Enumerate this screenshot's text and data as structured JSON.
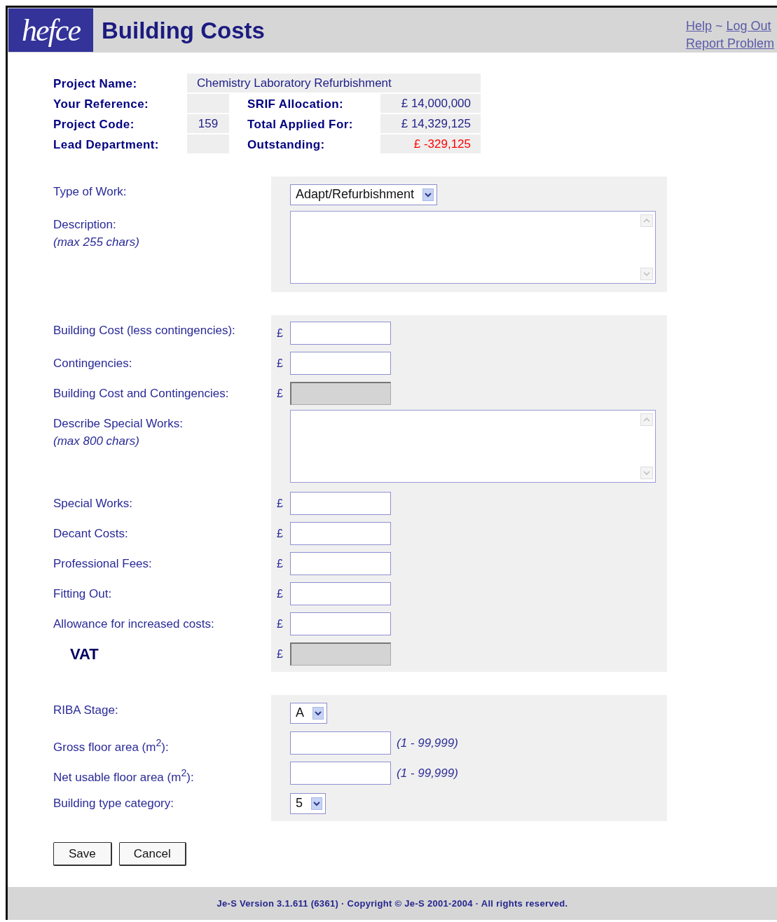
{
  "header": {
    "logo": "hefce",
    "title": "Building Costs",
    "links": [
      {
        "label": "Help"
      },
      {
        "label": "Log Out"
      }
    ],
    "separator": "~",
    "second_link": {
      "label": "Report Problem"
    }
  },
  "summary": {
    "name_label": "Project Name:",
    "name_value": "Chemistry Laboratory Refurbishment",
    "rows": [
      {
        "label": "Your Reference:",
        "label2": "SRIF Allocation:",
        "value2": "£ 14,000,000",
        "alert": false
      },
      {
        "label": "Project Code:",
        "value": "159",
        "label2": "Total Applied For:",
        "value2": "£ 14,329,125",
        "alert": false
      },
      {
        "label": "Lead Department:",
        "label2": "Outstanding:",
        "value2": "£ -329,125",
        "alert": true
      }
    ]
  },
  "sections": [
    {
      "rows": [
        {
          "kind": "select",
          "label": "Type of Work:",
          "value": "Adapt/Refurbishment"
        },
        {
          "kind": "textarea",
          "label": "Description:",
          "note": "(max 255 chars)"
        }
      ]
    },
    {
      "rows": [
        {
          "kind": "money",
          "label": "Building Cost (less contingencies):",
          "currency": "£",
          "disabled": false
        },
        {
          "kind": "money",
          "label": "Contingencies:",
          "currency": "£",
          "disabled": false
        },
        {
          "kind": "money",
          "label": "Building Cost and Contingencies:",
          "currency": "£",
          "disabled": true
        },
        {
          "kind": "textarea",
          "label": "Describe Special Works:",
          "note": "(max 800 chars)"
        },
        {
          "kind": "money",
          "label": "Special Works:",
          "currency": "£",
          "disabled": false
        },
        {
          "kind": "money",
          "label": "Decant Costs:",
          "currency": "£",
          "disabled": false
        },
        {
          "kind": "money",
          "label": "Professional Fees:",
          "currency": "£",
          "disabled": false
        },
        {
          "kind": "money",
          "label": "Fitting Out:",
          "currency": "£",
          "disabled": false
        },
        {
          "kind": "money",
          "label": "Allowance for increased costs:",
          "currency": "£",
          "disabled": false
        },
        {
          "kind": "money",
          "label": "VAT",
          "emphasis": true,
          "currency": "£",
          "disabled": true
        }
      ]
    },
    {
      "rows": [
        {
          "kind": "select",
          "label": "RIBA Stage:",
          "value": "A"
        },
        {
          "kind": "number",
          "label": "Gross floor area (m$^{2}$):",
          "hint": "(1 - 99,999)"
        },
        {
          "kind": "number",
          "label": "Net usable floor area (m$^{2}$):",
          "hint": "(1 - 99,999)"
        },
        {
          "kind": "select",
          "label": "Building type category:",
          "value": "5"
        }
      ]
    }
  ],
  "buttons": [
    "Save",
    "Cancel"
  ],
  "footer": "Je-S Version 3.1.611 (6361) · Copyright © Je-S 2001-2004 · All rights reserved."
}
